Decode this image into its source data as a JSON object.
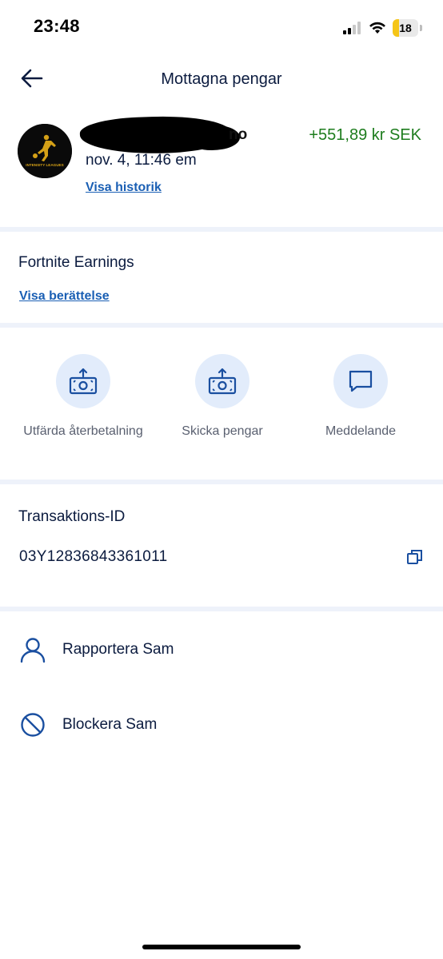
{
  "status_bar": {
    "time": "23:48",
    "battery": "18"
  },
  "header": {
    "title": "Mottagna pengar"
  },
  "sender": {
    "name_visible": "no",
    "date": "nov. 4, 11:46 em",
    "amount": "+551,89 kr SEK",
    "history_link": "Visa historik",
    "avatar_text": "INTENSITY LEAGUES"
  },
  "note": {
    "title": "Fortnite Earnings",
    "story_link": "Visa berättelse"
  },
  "actions": [
    {
      "label": "Utfärda återbetalning"
    },
    {
      "label": "Skicka pengar"
    },
    {
      "label": "Meddelande"
    }
  ],
  "transaction": {
    "label": "Transaktions-ID",
    "id": "03Y12836843361011"
  },
  "menu": [
    {
      "label": "Rapportera Sam",
      "icon": "person-icon"
    },
    {
      "label": "Blockera Sam",
      "icon": "block-icon"
    }
  ],
  "colors": {
    "amount": "#1d7c1d",
    "link": "#1a5fb4",
    "icon": "#1a4fa0",
    "divider": "#eef2fa"
  }
}
